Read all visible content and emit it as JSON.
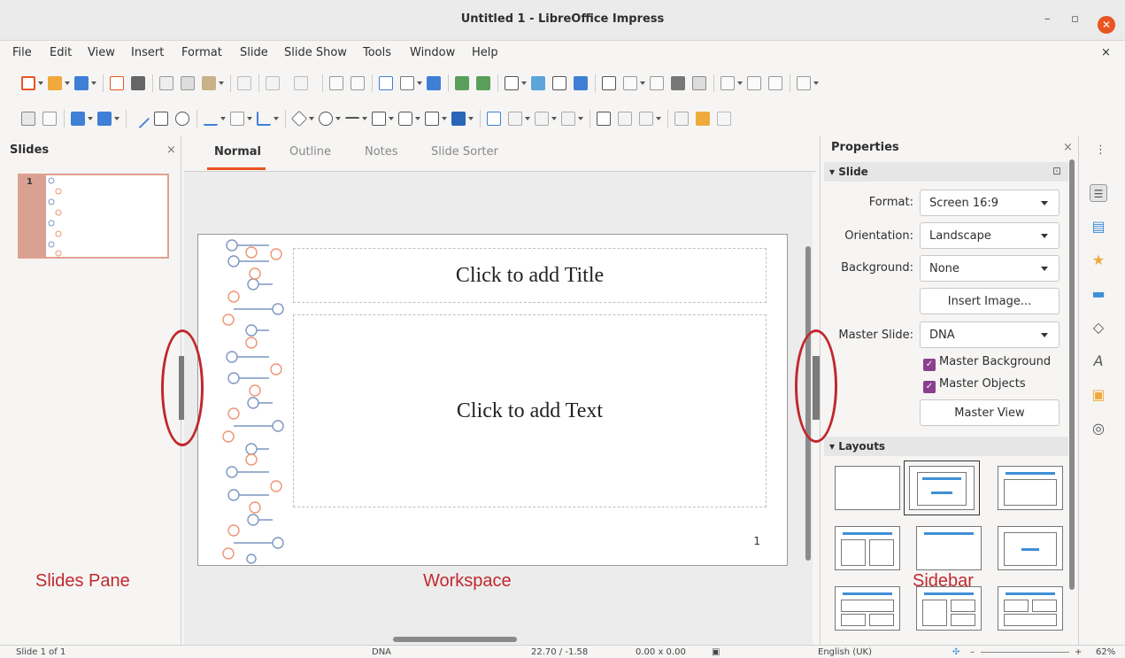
{
  "window": {
    "title": "Untitled 1 - LibreOffice Impress",
    "minimize": "–",
    "restore": "▫",
    "close": "✕",
    "doc_close": "×"
  },
  "menu": [
    "File",
    "Edit",
    "View",
    "Insert",
    "Format",
    "Slide",
    "Slide Show",
    "Tools",
    "Window",
    "Help"
  ],
  "slides_pane": {
    "title": "Slides",
    "close": "×",
    "thumbnails": [
      {
        "number": "1"
      }
    ]
  },
  "view_tabs": [
    "Normal",
    "Outline",
    "Notes",
    "Slide Sorter"
  ],
  "slide": {
    "title_placeholder": "Click to add Title",
    "text_placeholder": "Click to add Text",
    "page_number": "1"
  },
  "sidebar": {
    "title": "Properties",
    "close": "×",
    "more": "⋮",
    "slide_section": "Slide",
    "format_label": "Format:",
    "format_value": "Screen 16:9",
    "orientation_label": "Orientation:",
    "orientation_value": "Landscape",
    "background_label": "Background:",
    "background_value": "None",
    "insert_image": "Insert Image...",
    "master_slide_label": "Master Slide:",
    "master_slide_value": "DNA",
    "master_background": "Master Background",
    "master_objects": "Master Objects",
    "master_view": "Master View",
    "layouts_section": "Layouts"
  },
  "deck_icons": [
    "properties-icon",
    "slide-transition-icon",
    "animation-icon",
    "master-slides-icon",
    "shapes-icon",
    "styles-icon",
    "gallery-icon",
    "navigator-icon"
  ],
  "statusbar": {
    "slide_info": "Slide 1 of 1",
    "master": "DNA",
    "position": "22.70 / -1.58",
    "size": "0.00 x 0.00",
    "language": "English (UK)",
    "zoom_minus": "–",
    "zoom_plus": "+",
    "zoom": "62%"
  },
  "annotations": {
    "slides_pane": "Slides Pane",
    "workspace": "Workspace",
    "sidebar": "Sidebar"
  },
  "colors": {
    "accent": "#e95420",
    "annotation_red": "#c0282d",
    "dna_orange": "#ee9471",
    "dna_blue": "#7c96c2",
    "checkbox_purple": "#8b3f8f"
  }
}
